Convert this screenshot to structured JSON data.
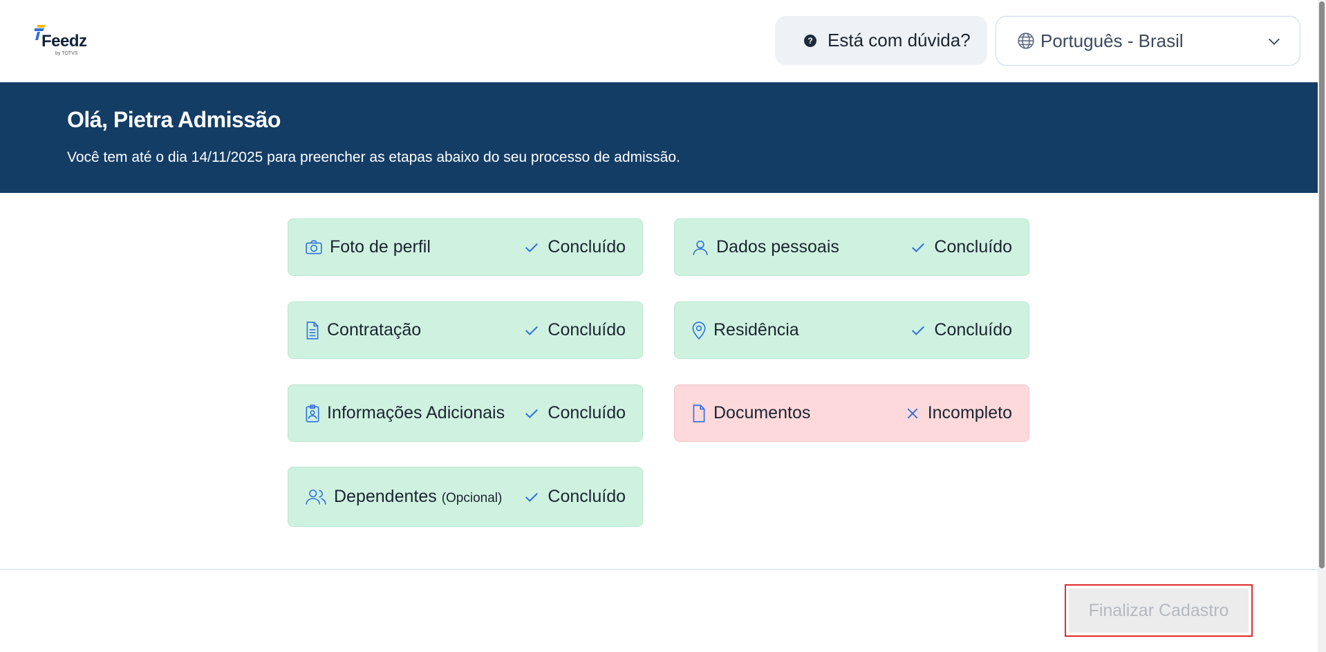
{
  "header": {
    "logo_text": "Feedz",
    "logo_sub": "by TOTVS",
    "help_label": "Está com dúvida?",
    "help_icon": "question-circle-icon",
    "language_label": "Português - Brasil"
  },
  "banner": {
    "greeting": "Olá, Pietra Admissão",
    "deadline_text": "Você tem até o dia 14/11/2025 para preencher as etapas abaixo do seu processo de admissão."
  },
  "steps": [
    {
      "title": "Foto de perfil",
      "icon": "camera-icon",
      "status": "Concluído",
      "state": "done"
    },
    {
      "title": "Dados pessoais",
      "icon": "user-icon",
      "status": "Concluído",
      "state": "done"
    },
    {
      "title": "Contratação",
      "icon": "document-icon",
      "status": "Concluído",
      "state": "done"
    },
    {
      "title": "Residência",
      "icon": "map-pin-icon",
      "status": "Concluído",
      "state": "done"
    },
    {
      "title": "Informações Adicionais",
      "icon": "badge-icon",
      "status": "Concluído",
      "state": "done"
    },
    {
      "title": "Documentos",
      "icon": "file-icon",
      "status": "Incompleto",
      "state": "incomplete"
    },
    {
      "title": "Dependentes",
      "optional": "(Opcional)",
      "icon": "users-icon",
      "status": "Concluído",
      "state": "done"
    }
  ],
  "footer": {
    "finish_label": "Finalizar Cadastro"
  },
  "colors": {
    "banner": "#143d66",
    "done_bg": "#cff2e0",
    "incomplete_bg": "#fdd9dc",
    "icon_blue": "#2f6fe0",
    "highlight_red": "#e02b2b"
  }
}
